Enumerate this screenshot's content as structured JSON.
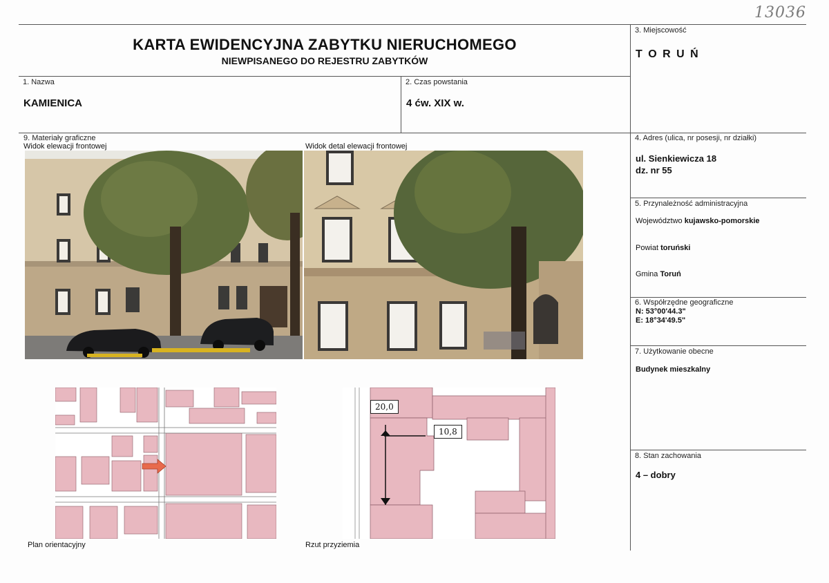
{
  "corner_note": "13036",
  "header": {
    "title": "KARTA EWIDENCYJNA ZABYTKU NIERUCHOMEGO",
    "subtitle": "NIEWPISANEGO DO REJESTRU ZABYTKÓW"
  },
  "locality": {
    "label": "3. Miejscowość",
    "value": "T O R U Ń"
  },
  "name": {
    "label": "1. Nazwa",
    "value": "KAMIENICA"
  },
  "period": {
    "label": "2. Czas powstania",
    "value": "4 ćw. XIX w."
  },
  "graphics": {
    "label": "9. Materiały graficzne",
    "photo1_caption": "Widok elewacji frontowej",
    "photo2_caption": "Widok detal elewacji frontowej",
    "map_caption": "Plan orientacyjny",
    "plan_caption": "Rzut przyziemia",
    "dim_width": "20,0",
    "dim_depth": "10,8"
  },
  "address": {
    "label": "4. Adres (ulica, nr posesji, nr działki)",
    "line1": "ul. Sienkiewicza 18",
    "line2": "dz. nr 55"
  },
  "admin": {
    "label": "5. Przynależność administracyjna",
    "voivodeship_prefix": "Województwo ",
    "voivodeship": "kujawsko-pomorskie",
    "county_prefix": "Powiat ",
    "county": "toruński",
    "commune_prefix": "Gmina ",
    "commune": "Toruń"
  },
  "geo": {
    "label": "6. Współrzędne geograficzne",
    "n": "N: 53°00'44.3\"",
    "e": "E: 18°34'49.5\""
  },
  "usage": {
    "label": "7. Użytkowanie obecne",
    "value": "Budynek mieszkalny"
  },
  "condition": {
    "label": "8. Stan zachowania",
    "value": "4 – dobry"
  }
}
